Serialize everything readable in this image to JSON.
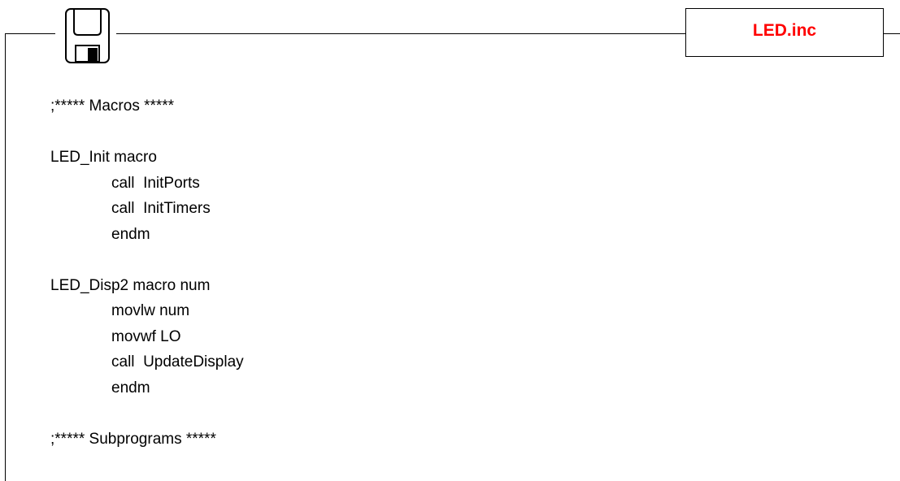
{
  "file": {
    "name": "LED.inc",
    "name_color": "#ff0000",
    "icon": "floppy-disk-icon"
  },
  "code": {
    "lines": [
      {
        "text": ";***** Macros *****",
        "indent": 0
      },
      {
        "text": "",
        "indent": 0
      },
      {
        "text": "LED_Init macro",
        "indent": 0
      },
      {
        "text": "call  InitPorts",
        "indent": 1
      },
      {
        "text": "call  InitTimers",
        "indent": 1
      },
      {
        "text": "endm",
        "indent": 1
      },
      {
        "text": "",
        "indent": 0
      },
      {
        "text": "LED_Disp2 macro num",
        "indent": 0
      },
      {
        "text": "movlw num",
        "indent": 1
      },
      {
        "text": "movwf LO",
        "indent": 1
      },
      {
        "text": "call  UpdateDisplay",
        "indent": 1
      },
      {
        "text": "endm",
        "indent": 1
      },
      {
        "text": "",
        "indent": 0
      },
      {
        "text": ";***** Subprograms *****",
        "indent": 0
      }
    ]
  }
}
